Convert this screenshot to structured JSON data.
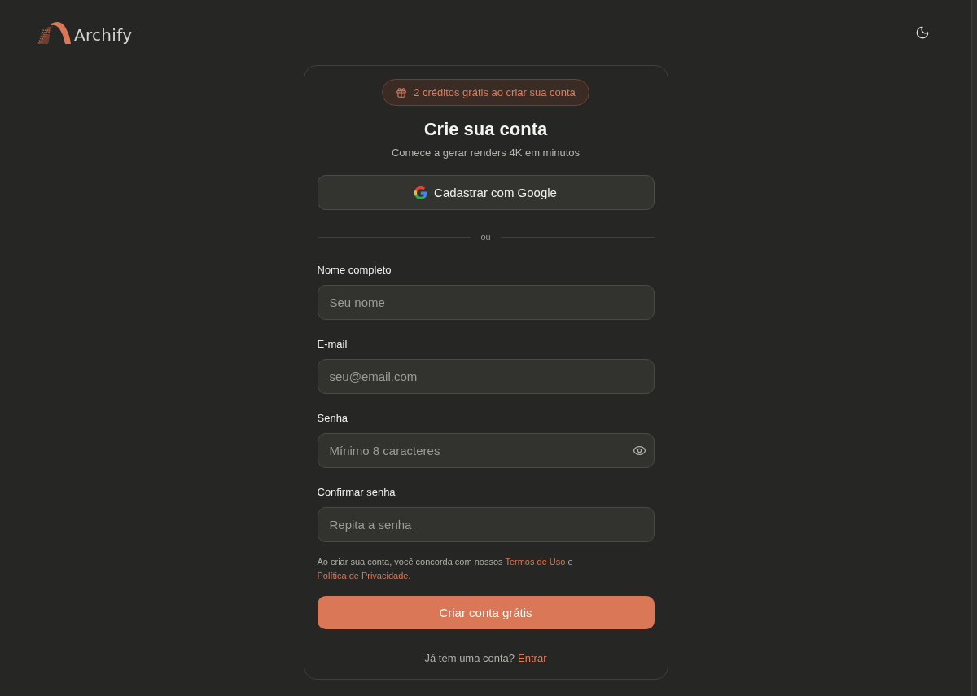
{
  "header": {
    "logo_text": "Archify"
  },
  "card": {
    "badge": "2 créditos grátis ao criar sua conta",
    "title": "Crie sua conta",
    "subtitle": "Comece a gerar renders 4K em minutos",
    "google_button": "Cadastrar com Google",
    "divider": "ou",
    "fields": [
      {
        "label": "Nome completo",
        "placeholder": "Seu nome",
        "kind": "text"
      },
      {
        "label": "E-mail",
        "placeholder": "seu@email.com",
        "kind": "email"
      },
      {
        "label": "Senha",
        "placeholder": "Mínimo 8 caracteres",
        "kind": "password-reveal"
      },
      {
        "label": "Confirmar senha",
        "placeholder": "Repita a senha",
        "kind": "password"
      }
    ],
    "terms": [
      {
        "kind": "text",
        "text": "Ao criar sua conta, você concorda com nossos "
      },
      {
        "kind": "link",
        "text": "Termos de Uso"
      },
      {
        "kind": "text",
        "text": " e "
      },
      {
        "kind": "link",
        "text": "Política de Privacidade"
      },
      {
        "kind": "text",
        "text": "."
      }
    ],
    "submit_button": "Criar conta grátis",
    "footer": {
      "text": "Já tem uma conta?",
      "link": "Entrar"
    }
  }
}
